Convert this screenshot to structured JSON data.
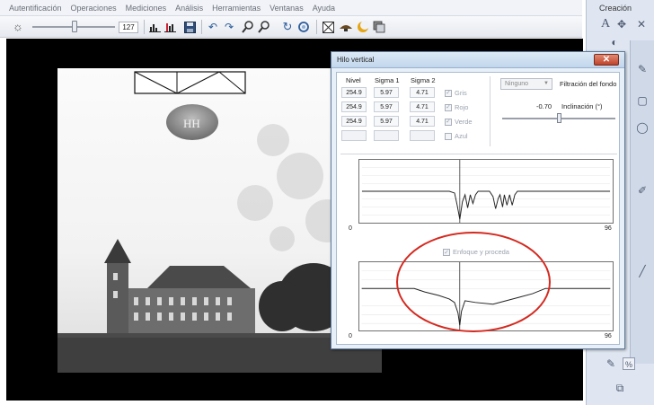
{
  "menu": [
    "Autentificación",
    "Operaciones",
    "Mediciones",
    "Análisis",
    "Herramientas",
    "Ventanas",
    "Ayuda"
  ],
  "toolbar": {
    "brightness_value": "127",
    "brightness_icon": "sun-icon",
    "icons": [
      "histogram-icon",
      "histogram-2-icon",
      "save-icon",
      "undo-icon",
      "redo-icon",
      "zoom-in-icon",
      "zoom-out-icon",
      "rotate-right-icon",
      "rotate-left-icon",
      "grid-icon",
      "lamp-icon",
      "moon-icon",
      "layers-icon"
    ]
  },
  "right_panel": {
    "title": "Creación",
    "icons": [
      "text-icon",
      "cursor-icon",
      "pen-icon",
      "color-picker-icon",
      "percent-icon",
      "copy-icon"
    ],
    "percent_label": "%"
  },
  "image": {
    "ufo_label": "HH"
  },
  "dialog": {
    "title": "Hilo vertical",
    "close_label": "✕",
    "columns": [
      "Nivel",
      "Sigma 1",
      "Sigma 2"
    ],
    "rows": [
      {
        "nivel": "254.9",
        "sigma1": "5.97",
        "sigma2": "4.71",
        "channel": "Gris",
        "checked": true
      },
      {
        "nivel": "254.9",
        "sigma1": "5.97",
        "sigma2": "4.71",
        "channel": "Rojo",
        "checked": true
      },
      {
        "nivel": "254.9",
        "sigma1": "5.97",
        "sigma2": "4.71",
        "channel": "Verde",
        "checked": true
      },
      {
        "nivel": "",
        "sigma1": "",
        "sigma2": "",
        "channel": "Azul",
        "checked": false
      }
    ],
    "filter_select": "Ninguno",
    "filter_label": "Filtración del fondo",
    "inclination_value": "-0.70",
    "inclination_label": "Inclinación (°)",
    "graph1": {
      "x_min": "0",
      "x_max": "96"
    },
    "process_checkbox": "Enfoque y proceda",
    "graph2": {
      "x_min": "0",
      "x_max": "96"
    }
  },
  "colors": {
    "highlight_ring": "#d42a20",
    "canvas": "#000000"
  }
}
